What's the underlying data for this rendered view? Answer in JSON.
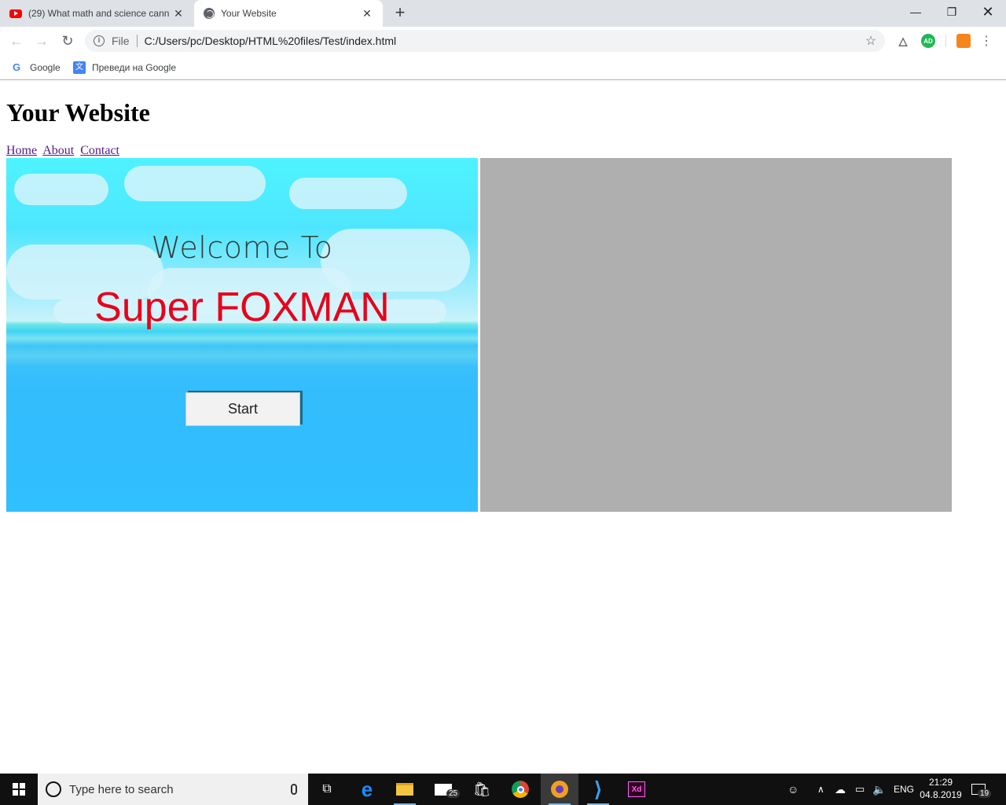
{
  "browser": {
    "tabs": [
      {
        "title": "(29) What math and science cann",
        "icon": "youtube-icon"
      },
      {
        "title": "Your Website",
        "icon": "globe-icon"
      }
    ],
    "url_scheme": "File",
    "url": "C:/Users/pc/Desktop/HTML%20files/Test/index.html",
    "bookmarks": [
      {
        "label": "Google",
        "icon": "google-icon"
      },
      {
        "label": "Преведи на Google",
        "icon": "google-translate-icon"
      }
    ],
    "extensions": [
      {
        "label": "AD",
        "color": "#1db954"
      }
    ]
  },
  "page": {
    "heading": "Your Website",
    "nav": [
      {
        "label": "Home"
      },
      {
        "label": "About"
      },
      {
        "label": "Contact"
      }
    ],
    "game": {
      "welcome": "Welcome To",
      "title": "Super FOXMAN",
      "start_label": "Start",
      "title_color": "#e8001b"
    }
  },
  "taskbar": {
    "search_placeholder": "Type here to search",
    "mail_badge": "25",
    "language": "ENG",
    "time": "21:29",
    "date": "04.8.2019",
    "notification_count": "19"
  }
}
